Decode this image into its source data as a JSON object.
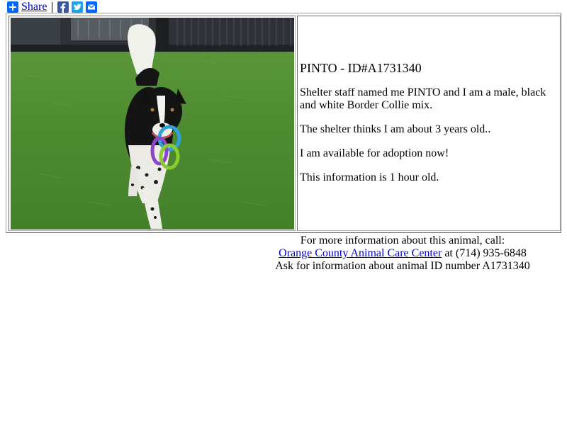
{
  "share": {
    "label": "Share",
    "icons": [
      "plus-icon",
      "facebook-icon",
      "twitter-icon",
      "email-icon"
    ]
  },
  "animal": {
    "title": "PINTO - ID#A1731340",
    "description": "Shelter staff named me PINTO and I am a male, black and white Border Collie mix.",
    "age": "The shelter thinks I am about 3 years old..",
    "availability": "I am available for adoption now!",
    "freshness": "This information is 1 hour old."
  },
  "contact": {
    "intro": "For more information about this animal, call:",
    "shelter_name": "Orange County Animal Care Center",
    "phone_text": " at (714) 935-6848",
    "ask_text": "Ask for information about animal ID number A1731340"
  },
  "colors": {
    "link": "#0000cc",
    "share_blue": "#0166ff",
    "facebook": "#3b5998",
    "twitter": "#1da1f2"
  }
}
